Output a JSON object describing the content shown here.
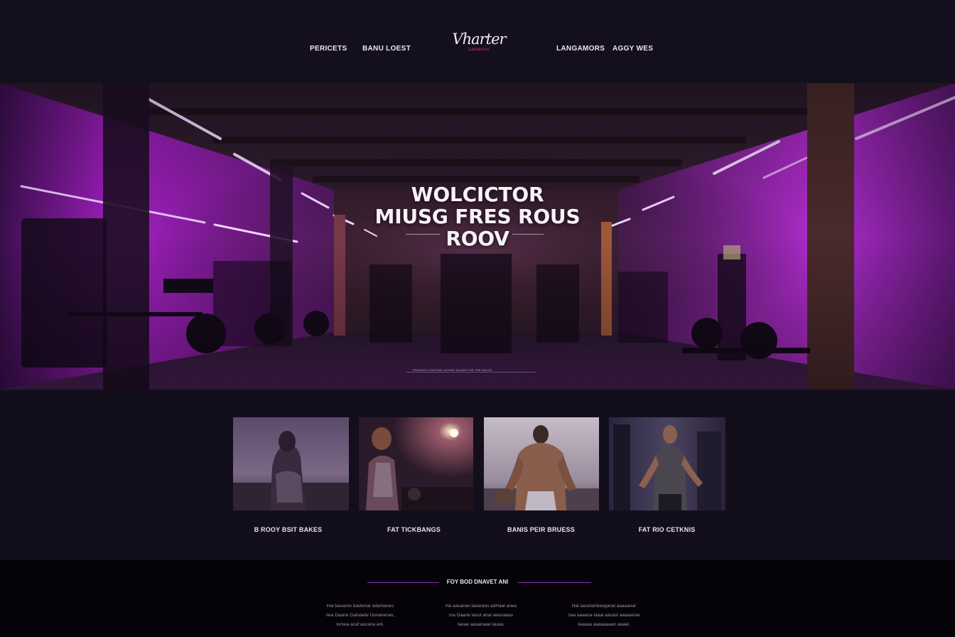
{
  "header": {
    "nav_left": [
      "PERICETS",
      "BANU LOEST"
    ],
    "nav_right": [
      "LANGAMORS",
      "AGGY WES"
    ],
    "logo_script": "Vharter",
    "logo_sub": "Lamasins"
  },
  "hero": {
    "title_lines": [
      "WOLCICTOR",
      "MIUSG FRES ROUS",
      "ROOV"
    ],
    "caption": "TREIKSES CONTIDE LATERE SLAINS FOR TRE EELGS"
  },
  "cards": [
    {
      "label": "B ROOY BSIT BAKES",
      "image": "woman-training-photo"
    },
    {
      "label": "FAT TICKBANGS",
      "image": "athlete-gym-photo"
    },
    {
      "label": "BANIS PEIR BRUESS",
      "image": "muscular-man-photo"
    },
    {
      "label": "FAT RIO CETKNIS",
      "image": "man-in-gym-photo"
    }
  ],
  "footer": {
    "title": "FOY BOD DNAVET ANI",
    "columns": [
      [
        "Hal bauame bastenar adamanes",
        "nea Daane Gatoaele Uonanenas,",
        "lursea acaf ascana anl."
      ],
      [
        "Ha aasanas laearaos adHaal anea",
        "ma Daane tasot anal aeanaaas",
        "laeae aasanaae lauaa."
      ],
      [
        "Hal aasetanbasganal aaaaanar",
        "naa aaaana laaal aasasl aaaaanae",
        "laaaaa aaaaaaaan aaaal."
      ]
    ],
    "accent": "#8e2cb2"
  },
  "colors": {
    "background": "#130e1c",
    "neon": "#c33be0",
    "brand_pink": "#e2387e"
  }
}
